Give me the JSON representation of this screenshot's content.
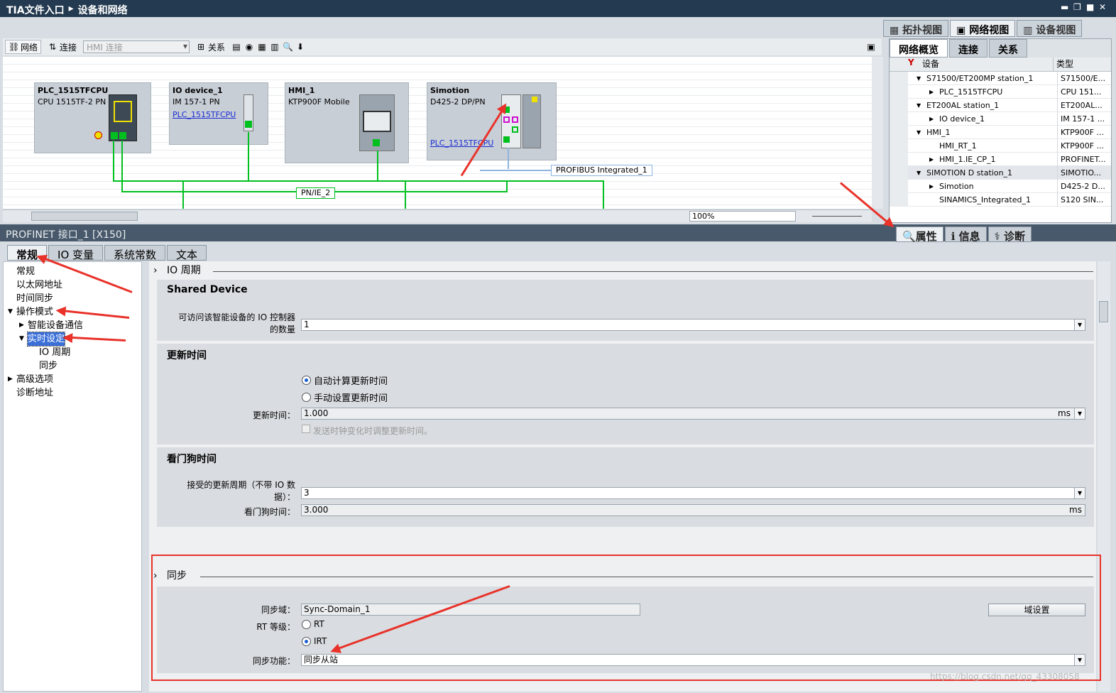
{
  "titlebar": {
    "app": "TIA文件入口",
    "sep": "▸",
    "page": "设备和网络"
  },
  "view_tabs": [
    "拓扑视图",
    "网络视图",
    "设备视图"
  ],
  "toolbar": {
    "network": "网络",
    "connect": "连接",
    "hmi_select": "HMI 连接",
    "relation": "关系"
  },
  "devices": [
    {
      "name": "PLC_1515TFCPU",
      "type": "CPU 1515TF-2 PN",
      "link": ""
    },
    {
      "name": "IO device_1",
      "type": "IM 157-1 PN",
      "link": "PLC_1515TFCPU"
    },
    {
      "name": "HMI_1",
      "type": "KTP900F Mobile",
      "link": ""
    },
    {
      "name": "Simotion",
      "type": "D425-2 DP/PN",
      "link": "PLC_1515TFCPU"
    }
  ],
  "networks": {
    "pn": "PN/IE_2",
    "profibus": "PROFIBUS Integrated_1"
  },
  "zoom": "100%",
  "overview": {
    "tabs": [
      "网络概览",
      "连接",
      "关系"
    ],
    "headers": {
      "device": "设备",
      "type": "类型"
    },
    "rows": [
      {
        "name": "S71500/ET200MP station_1",
        "type": "S71500/E...",
        "indent": 1,
        "expanded": true
      },
      {
        "name": "PLC_1515TFCPU",
        "type": "CPU 151...",
        "indent": 2,
        "expanded": false
      },
      {
        "name": "ET200AL station_1",
        "type": "ET200AL...",
        "indent": 1,
        "expanded": true
      },
      {
        "name": "IO device_1",
        "type": "IM 157-1 ...",
        "indent": 2,
        "expanded": false
      },
      {
        "name": "HMI_1",
        "type": "KTP900F ...",
        "indent": 1,
        "expanded": true
      },
      {
        "name": "HMI_RT_1",
        "type": "KTP900F ...",
        "indent": 2,
        "expanded": null
      },
      {
        "name": "HMI_1.IE_CP_1",
        "type": "PROFINET...",
        "indent": 2,
        "expanded": false
      },
      {
        "name": "SIMOTION D station_1",
        "type": "SIMOTIO...",
        "indent": 1,
        "expanded": true,
        "sel": true
      },
      {
        "name": "Simotion",
        "type": "D425-2 D...",
        "indent": 2,
        "expanded": false
      },
      {
        "name": "SINAMICS_Integrated_1",
        "type": "S120 SIN...",
        "indent": 2,
        "expanded": null
      }
    ]
  },
  "props": {
    "title": "PROFINET 接口_1 [X150]",
    "right_tabs": [
      "属性",
      "信息",
      "诊断"
    ],
    "sub_tabs": [
      "常规",
      "IO 变量",
      "系统常数",
      "文本"
    ]
  },
  "nav": [
    {
      "label": "常规",
      "level": 0,
      "tri": ""
    },
    {
      "label": "以太网地址",
      "level": 0,
      "tri": ""
    },
    {
      "label": "时间同步",
      "level": 0,
      "tri": ""
    },
    {
      "label": "操作模式",
      "level": 0,
      "tri": "▼"
    },
    {
      "label": "智能设备通信",
      "level": 1,
      "tri": "▶"
    },
    {
      "label": "实时设定",
      "level": 1,
      "tri": "▼",
      "sel": true
    },
    {
      "label": "IO 周期",
      "level": 2,
      "tri": ""
    },
    {
      "label": "同步",
      "level": 2,
      "tri": ""
    },
    {
      "label": "高级选项",
      "level": 0,
      "tri": "▶"
    },
    {
      "label": "诊断地址",
      "level": 0,
      "tri": ""
    }
  ],
  "io_cycle": {
    "header": "IO 周期",
    "shared_title": "Shared Device",
    "shared_label": "可访问该智能设备的 IO 控制器的数量",
    "shared_value": "1",
    "update_title": "更新时间",
    "auto": "自动计算更新时间",
    "manual": "手动设置更新时间",
    "update_label": "更新时间：",
    "update_value": "1.000",
    "update_unit": "ms",
    "checkbox": "发送时钟变化时调整更新时间。",
    "watchdog_title": "看门狗时间",
    "accepted_label": "接受的更新周期（不带 IO 数据）：",
    "accepted_value": "3",
    "watchdog_label": "看门狗时间：",
    "watchdog_value": "3.000",
    "watchdog_unit": "ms"
  },
  "sync": {
    "header": "同步",
    "domain_label": "同步域：",
    "domain_value": "Sync-Domain_1",
    "domain_btn": "域设置",
    "rt_label": "RT 等级：",
    "rt": "RT",
    "irt": "IRT",
    "func_label": "同步功能：",
    "func_value": "同步从站"
  },
  "watermark": "https://blog.csdn.net/qq_43308058",
  "colors": {
    "accent": "#e8322a",
    "network": "#00c020"
  }
}
